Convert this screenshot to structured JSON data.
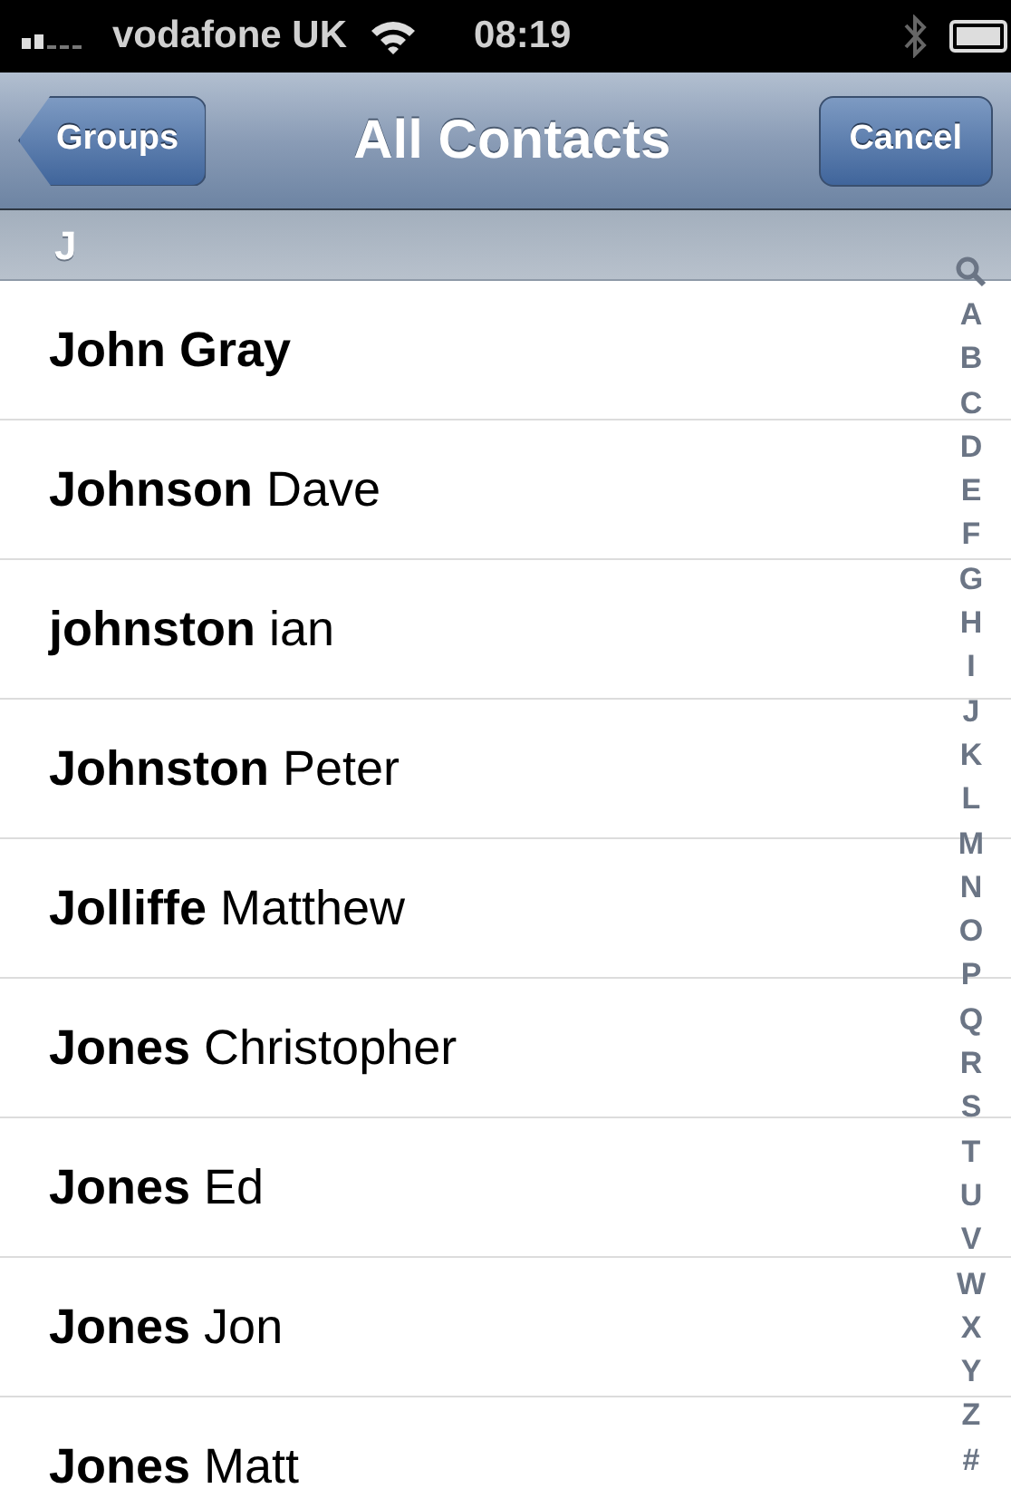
{
  "status_bar": {
    "carrier": "vodafone UK",
    "time": "08:19"
  },
  "nav_bar": {
    "back_button": "Groups",
    "title": "All Contacts",
    "right_button": "Cancel"
  },
  "section_header": "J",
  "contacts": [
    {
      "bold": "John Gray"
    },
    {
      "bold": "Johnson",
      "plain": "Dave"
    },
    {
      "bold": "johnston",
      "plain": "ian"
    },
    {
      "bold": "Johnston",
      "plain": "Peter"
    },
    {
      "bold": "Jolliffe",
      "plain": "Matthew"
    },
    {
      "bold": "Jones",
      "plain": "Christopher"
    },
    {
      "bold": "Jones",
      "plain": "Ed"
    },
    {
      "bold": "Jones",
      "plain": "Jon"
    },
    {
      "bold": "Jones",
      "plain": "Matt"
    }
  ],
  "index": [
    "A",
    "B",
    "C",
    "D",
    "E",
    "F",
    "G",
    "H",
    "I",
    "J",
    "K",
    "L",
    "M",
    "N",
    "O",
    "P",
    "Q",
    "R",
    "S",
    "T",
    "U",
    "V",
    "W",
    "X",
    "Y",
    "Z",
    "#"
  ]
}
